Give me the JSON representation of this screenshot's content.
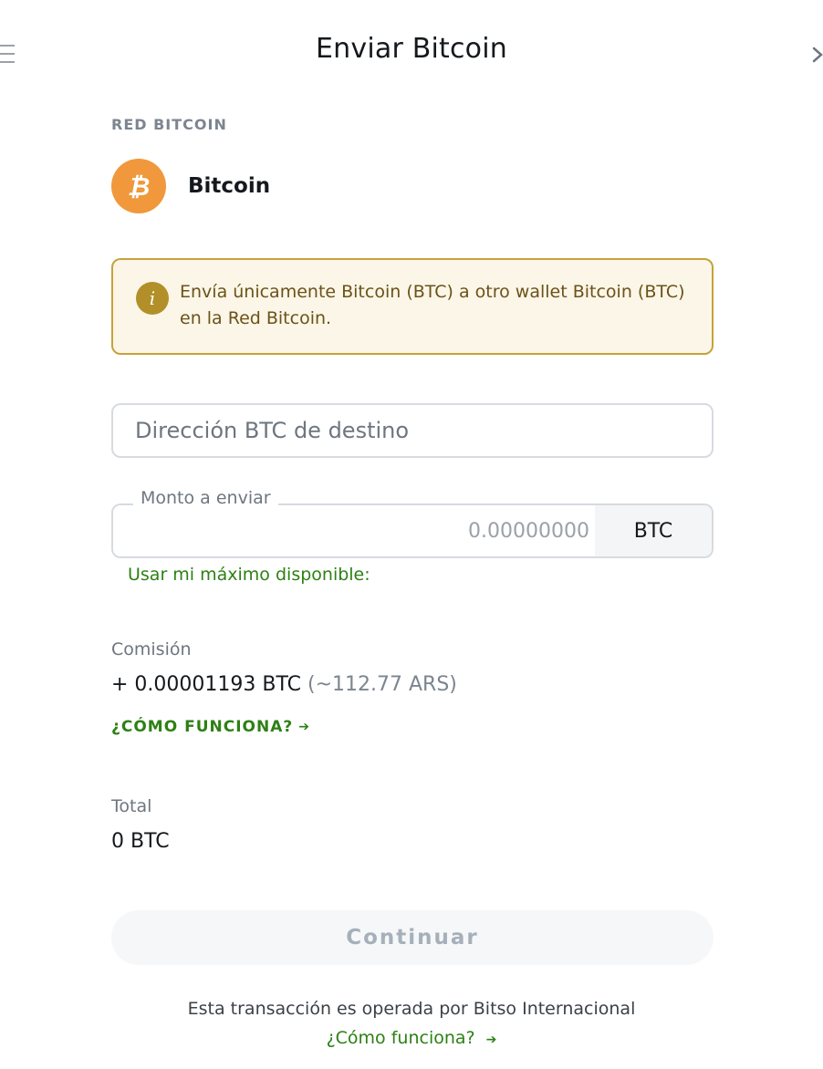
{
  "header": {
    "title": "Enviar Bitcoin",
    "back_icon": "back-lines-icon",
    "next_icon": "chevron-right-icon"
  },
  "network": {
    "label": "RED BITCOIN",
    "name": "Bitcoin",
    "icon": "bitcoin-icon",
    "icon_color": "#f0983b"
  },
  "warning": {
    "icon": "info-icon",
    "text": "Envía únicamente Bitcoin (BTC) a otro wallet Bitcoin (BTC) en la Red Bitcoin."
  },
  "address": {
    "placeholder": "Dirección BTC de destino",
    "value": ""
  },
  "amount": {
    "label": "Monto a enviar",
    "placeholder": "0.00000000",
    "value": "",
    "unit": "BTC",
    "max_link": "Usar mi máximo disponible:"
  },
  "fee": {
    "label": "Comisión",
    "value": "+ 0.00001193 BTC",
    "approx": "(~112.77 ARS)",
    "how_link": "¿CÓMO FUNCIONA?"
  },
  "total": {
    "label": "Total",
    "value": "0 BTC"
  },
  "actions": {
    "continue_label": "Continuar"
  },
  "footer": {
    "text": "Esta transacción es operada por Bitso Internacional",
    "link": "¿Cómo funciona?"
  },
  "colors": {
    "accent_green": "#2d8014",
    "warning_border": "#c5a23c",
    "warning_bg": "#fbf6e7"
  }
}
